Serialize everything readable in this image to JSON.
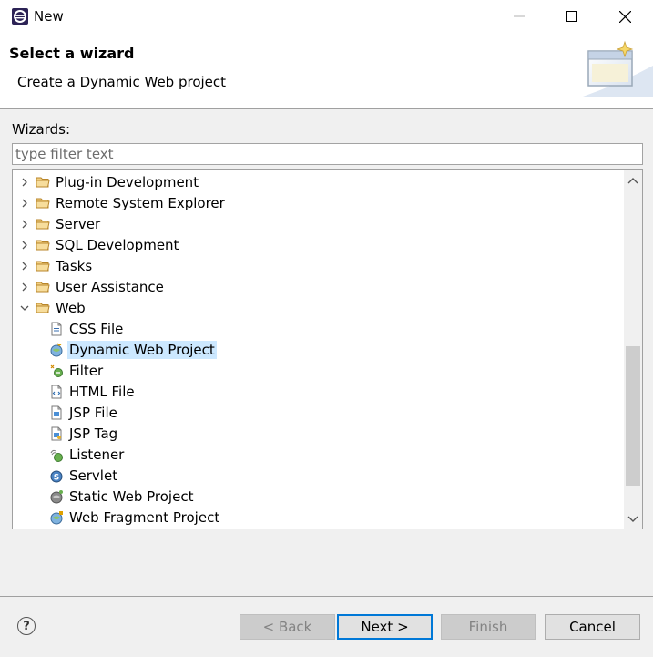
{
  "window": {
    "title": "New"
  },
  "header": {
    "title": "Select a wizard",
    "description": "Create a Dynamic Web project"
  },
  "wizards": {
    "label": "Wizards:",
    "filter_placeholder": "type filter text",
    "filter_value": "",
    "tree": [
      {
        "label": "Plug-in Development",
        "type": "folder",
        "expanded": false
      },
      {
        "label": "Remote System Explorer",
        "type": "folder",
        "expanded": false
      },
      {
        "label": "Server",
        "type": "folder",
        "expanded": false
      },
      {
        "label": "SQL Development",
        "type": "folder",
        "expanded": false
      },
      {
        "label": "Tasks",
        "type": "folder",
        "expanded": false
      },
      {
        "label": "User Assistance",
        "type": "folder",
        "expanded": false
      },
      {
        "label": "Web",
        "type": "folder",
        "expanded": true
      },
      {
        "label": "CSS File",
        "type": "item",
        "icon": "css-file-icon"
      },
      {
        "label": "Dynamic Web Project",
        "type": "item",
        "icon": "dynamic-web-project-icon",
        "selected": true
      },
      {
        "label": "Filter",
        "type": "item",
        "icon": "filter-icon"
      },
      {
        "label": "HTML File",
        "type": "item",
        "icon": "html-file-icon"
      },
      {
        "label": "JSP File",
        "type": "item",
        "icon": "jsp-file-icon"
      },
      {
        "label": "JSP Tag",
        "type": "item",
        "icon": "jsp-tag-icon"
      },
      {
        "label": "Listener",
        "type": "item",
        "icon": "listener-icon"
      },
      {
        "label": "Servlet",
        "type": "item",
        "icon": "servlet-icon"
      },
      {
        "label": "Static Web Project",
        "type": "item",
        "icon": "static-web-project-icon"
      },
      {
        "label": "Web Fragment Project",
        "type": "item",
        "icon": "web-fragment-project-icon"
      }
    ]
  },
  "buttons": {
    "back": "< Back",
    "next": "Next >",
    "finish": "Finish",
    "cancel": "Cancel"
  },
  "colors": {
    "selection": "#cce8ff",
    "default_button_border": "#0078d7",
    "folder": "#e8b84a"
  }
}
